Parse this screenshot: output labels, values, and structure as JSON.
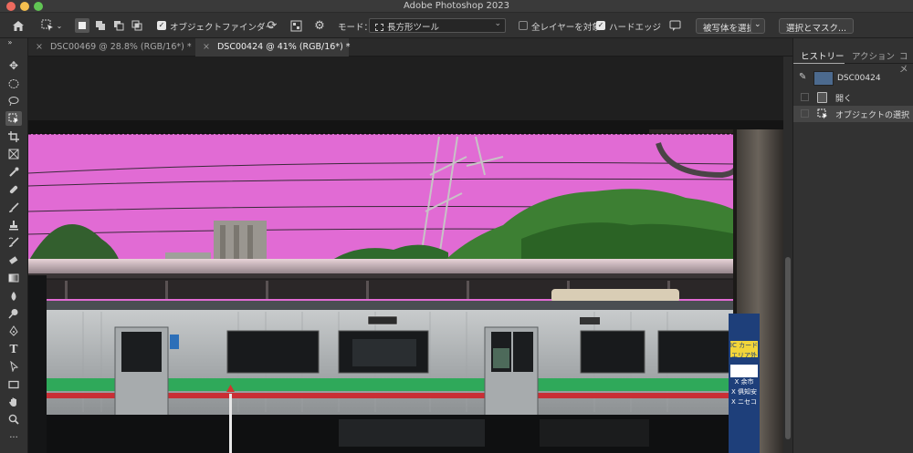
{
  "app": {
    "title": "Adobe Photoshop 2023"
  },
  "options_bar": {
    "object_finder_label": "オブジェクトファインダー",
    "mode_label": "モード：",
    "mode_value": "長方形ツール",
    "all_layers_label": "全レイヤーを対象",
    "hard_edge_label": "ハードエッジ",
    "select_subject_label": "被写体を選択",
    "select_and_mask_label": "選択とマスク...",
    "object_finder_checked": true,
    "all_layers_checked": false,
    "hard_edge_checked": true
  },
  "tabs": [
    {
      "label": "DSC00469 @ 28.8% (RGB/16*) *",
      "active": false
    },
    {
      "label": "DSC00424 @ 41% (RGB/16*) *",
      "active": true
    }
  ],
  "panel": {
    "tabs": [
      {
        "label": "ヒストリー",
        "active": true
      },
      {
        "label": "アクション",
        "active": false
      },
      {
        "label": "コメ",
        "active": false
      }
    ],
    "history": [
      {
        "label": "DSC00424",
        "type": "snapshot",
        "selected": false
      },
      {
        "label": "開く",
        "type": "step",
        "selected": false
      },
      {
        "label": "オブジェクトの選択",
        "type": "step",
        "selected": true
      }
    ]
  },
  "photo": {
    "train_sign_labels": [
      "IC カード",
      "エリア外",
      "X 余市",
      "X 俱知安",
      "X ニセコ"
    ]
  },
  "colors": {
    "selection_mask": "#e16bd4",
    "stripe_green": "#2fa95a",
    "stripe_red": "#c92f35"
  }
}
